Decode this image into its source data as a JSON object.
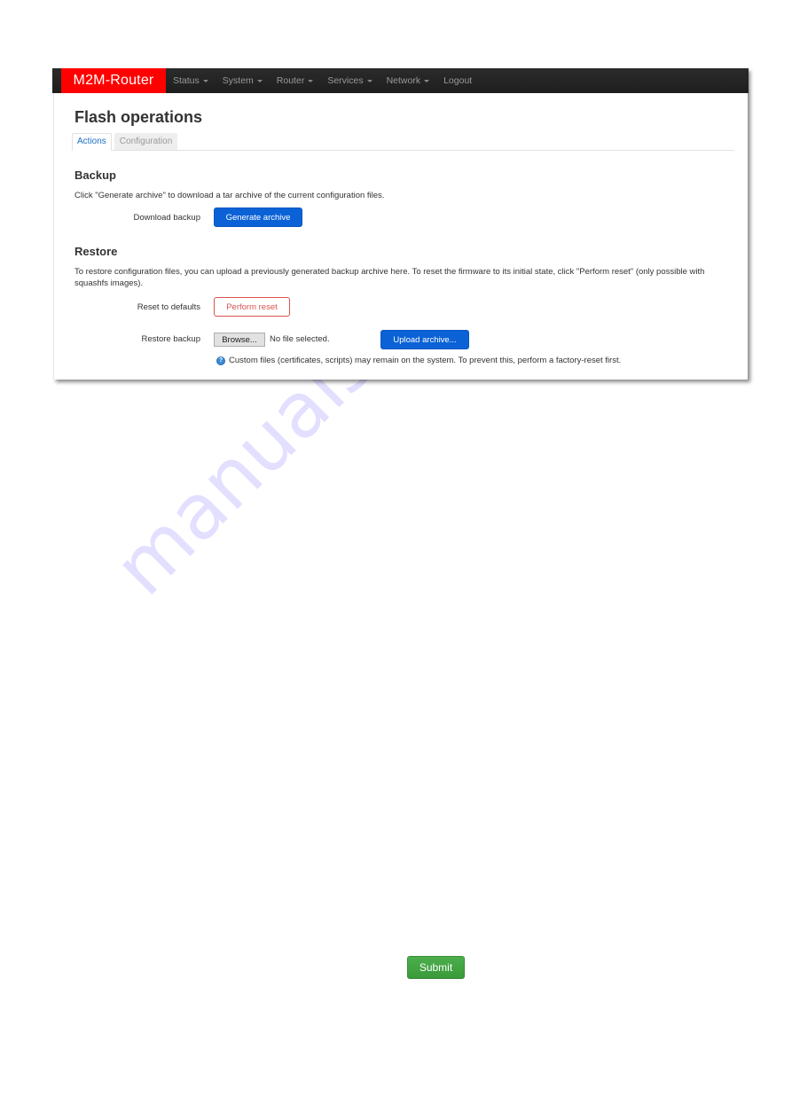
{
  "navbar": {
    "brand": "M2M-Router",
    "brand_color": "#ff0000",
    "items": [
      {
        "label": "Status",
        "has_dropdown": true
      },
      {
        "label": "System",
        "has_dropdown": true
      },
      {
        "label": "Router",
        "has_dropdown": true
      },
      {
        "label": "Services",
        "has_dropdown": true
      },
      {
        "label": "Network",
        "has_dropdown": true
      },
      {
        "label": "Logout",
        "has_dropdown": false
      }
    ]
  },
  "page": {
    "title": "Flash operations",
    "tabs": [
      {
        "label": "Actions",
        "active": true
      },
      {
        "label": "Configuration",
        "active": false
      }
    ]
  },
  "backup": {
    "title": "Backup",
    "description": "Click \"Generate archive\" to download a tar archive of the current configuration files.",
    "download_label": "Download backup",
    "generate_button": "Generate archive"
  },
  "restore": {
    "title": "Restore",
    "description": "To restore configuration files, you can upload a previously generated backup archive here. To reset the firmware to its initial state, click \"Perform reset\" (only possible with squashfs images).",
    "reset_label": "Reset to defaults",
    "reset_button": "Perform reset",
    "restore_label": "Restore backup",
    "browse_button": "Browse...",
    "file_status": "No file selected.",
    "upload_button": "Upload archive...",
    "info_icon": "help-circle-icon",
    "info_text": "Custom files (certificates, scripts) may remain on the system. To prevent this, perform a factory-reset first."
  },
  "footer": {
    "submit_button": "Submit"
  },
  "watermark": "manualshive.com"
}
